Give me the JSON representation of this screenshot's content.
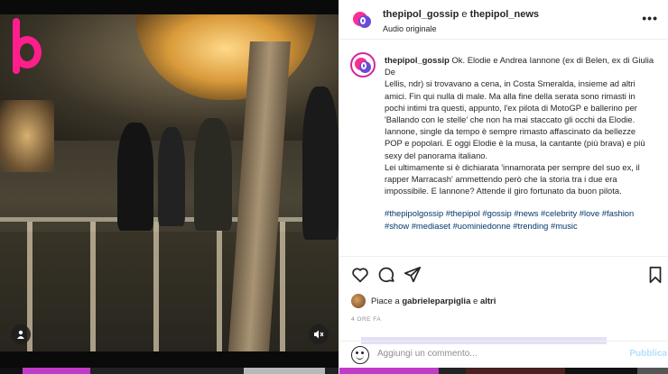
{
  "post": {
    "header": {
      "account1": "thepipol_gossip",
      "connector": "e",
      "account2": "thepipol_news",
      "audio": "Audio originale",
      "more": "•••"
    },
    "caption": {
      "username": "thepipol_gossip",
      "line1": "Ok. Elodie e Andrea Iannone (ex di Belen, ex di Giulia De",
      "para1": "Lellis, ndr) si trovavano a cena, in Costa Smeralda, insieme ad altri amici. Fin qui nulla di male. Ma alla fine della serata sono rimasti in pochi intimi tra questi, appunto, l'ex pilota di MotoGP e ballerino per 'Ballando con le stelle' che non ha mai staccato gli occhi da Elodie. Iannone, single da tempo è sempre rimasto affascinato da bellezze POP e popolari. E oggi Elodie è la musa, la cantante (più brava) e più sexy del panorama italiano.",
      "para2": "Lei ultimamente si è dichiarata 'innamorata per sempre del suo ex, il rapper Marracash' ammettendo però che la storia tra i due era impossibile. E Iannone? Attende il giro fortunato da buon pilota.",
      "hashtags": "#thepipolgossip #thepipol #gossip #news #celebrity #love #fashion #show #mediaset #uominiedonne #trending #music"
    },
    "likes": {
      "prefix": "Piace a",
      "user": "gabrieleparpiglia",
      "connector": "e",
      "others": "altri"
    },
    "time": "4 ORE FA",
    "comment": {
      "placeholder": "Aggiungi un commento...",
      "publish": "Pubblica"
    }
  },
  "icons": [
    "b-logo",
    "user-tag-icon",
    "mute-icon",
    "heart-icon",
    "comment-icon",
    "share-icon",
    "bookmark-icon",
    "emoji-icon"
  ],
  "colors": {
    "logo_pink": "#ff1e8c",
    "hashtag": "#00376b",
    "publish_disabled": "#b2dffc"
  }
}
